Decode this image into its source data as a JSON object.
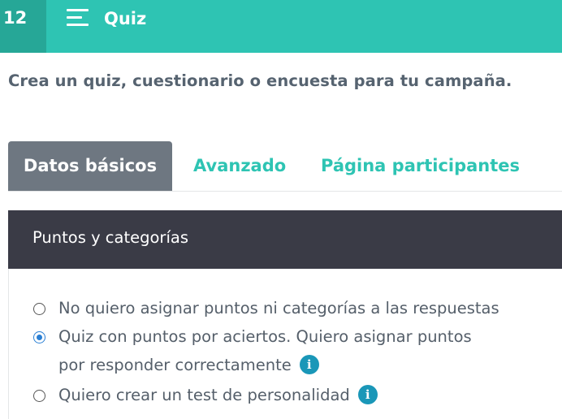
{
  "header": {
    "badge": "12",
    "title": "Quiz",
    "menu_icon": "hamburger-menu-icon",
    "colors": {
      "bar": "#2ec4b3",
      "badge": "#26a797"
    }
  },
  "subtitle": "Crea un quiz, cuestionario o encuesta para tu campaña.",
  "tabs": [
    {
      "label": "Datos básicos",
      "active": true
    },
    {
      "label": "Avanzado",
      "active": false
    },
    {
      "label": "Página participantes",
      "active": false
    }
  ],
  "panel": {
    "heading": "Puntos y categorías",
    "options": [
      {
        "line1": "No quiero asignar puntos ni categorías a las respuestas",
        "line2": "",
        "checked": false,
        "info": false
      },
      {
        "line1": "Quiz con puntos por aciertos. Quiero asignar puntos",
        "line2": "por responder correctamente",
        "checked": true,
        "info": true
      },
      {
        "line1": "Quiero crear un test de personalidad",
        "line2": "",
        "checked": false,
        "info": true
      }
    ],
    "info_icon_glyph": "i"
  }
}
